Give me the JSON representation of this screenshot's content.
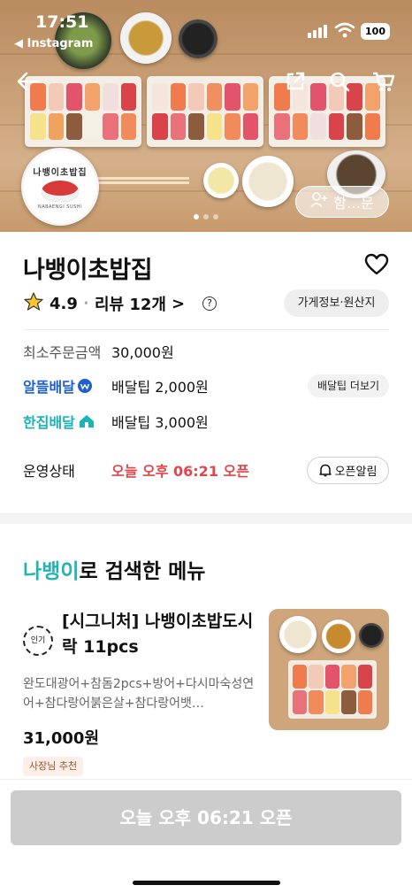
{
  "status_bar": {
    "time": "17:51",
    "back_app": "◀ Instagram",
    "battery": "100"
  },
  "hero": {
    "logo_text": "나뱅이초밥집",
    "logo_sub": "NABAENGI SUSHI",
    "group_order_label": "함…문",
    "carousel": {
      "total": 3,
      "active": 1
    }
  },
  "store": {
    "name": "나뱅이초밥집",
    "rating": "4.9",
    "review_label": "리뷰 12개",
    "review_chevron": ">",
    "help_icon": "?",
    "info_button": "가게정보·원산지"
  },
  "info": {
    "min_order_label": "최소주문금액",
    "min_order_value": "30,000원",
    "alttle_label": "알뜰배달",
    "alttle_tip": "배달팁 2,000원",
    "tip_more_button": "배달팁 더보기",
    "hanjip_label": "한집배달",
    "hanjip_tip": "배달팁 3,000원",
    "status_label": "운영상태",
    "status_value": "오늘 오후 06:21 오픈",
    "open_alarm_button": "오픈알림"
  },
  "search_section": {
    "highlight": "나뱅이",
    "rest": "로 검색한 메뉴"
  },
  "menu": [
    {
      "badge": "인기",
      "title": "[시그니처] 나뱅이초밥도시락 11pcs",
      "description": "완도대광어+참돔2pcs+방어+다시마숙성연어+참다랑어붉은살+참다랑어뱃…",
      "price": "31,000원",
      "tag": "사장님 추천"
    }
  ],
  "bottom": {
    "open_button": "오늘 오후 06:21 오픈"
  },
  "colors": {
    "alttle": "#1f5fd1",
    "hanjip": "#19b3b8",
    "highlight": "#24b3b5",
    "status_red": "#e4454a"
  }
}
